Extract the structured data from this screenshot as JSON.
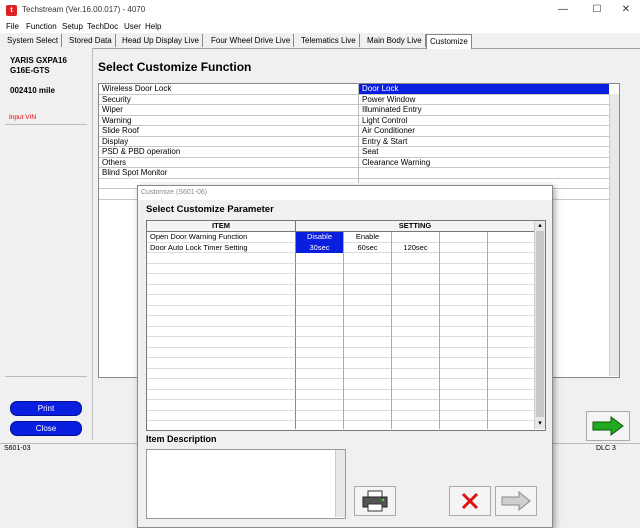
{
  "window": {
    "title": "Techstream (Ver.16.00.017) - 4070",
    "controls": {
      "minimize": "—",
      "maximize": "☐",
      "close": "✕"
    }
  },
  "menu": [
    "File",
    "Function",
    "Setup",
    "TechDoc",
    "User",
    "Help"
  ],
  "tabs": [
    "System Select",
    "Stored Data",
    "Head Up Display Live",
    "Four Wheel Drive Live",
    "Telematics Live",
    "Main Body Live",
    "Customize"
  ],
  "active_tab": "Customize",
  "vehicle": {
    "model": "YARIS GXPA16",
    "engine": "G16E-GTS",
    "mileage": "002410 mile",
    "input_vin": "Input VIN"
  },
  "left_buttons": {
    "print": "Print",
    "close": "Close"
  },
  "main": {
    "title": "Select Customize Function",
    "functions_left": [
      "Wireless Door Lock",
      "Security",
      "Wiper",
      "Warning",
      "Slide Roof",
      "Display",
      "PSD & PBD operation",
      "Others",
      "Blind Spot Monitor"
    ],
    "functions_right": [
      "Door Lock",
      "Power Window",
      "Illuminated Entry",
      "Light Control",
      "Air Conditioner",
      "Entry & Start",
      "Seat",
      "Clearance Warning"
    ],
    "selected_function": "Door Lock"
  },
  "status": {
    "left": "S601-03",
    "right": "DLC 3"
  },
  "dialog": {
    "title": "Customize (S601-06)",
    "heading": "Select Customize Parameter",
    "col_item": "ITEM",
    "col_setting": "SETTING",
    "rows": [
      {
        "item": "Open Door Warning Function",
        "options": [
          "Disable",
          "Enable"
        ],
        "selected": "Disable"
      },
      {
        "item": "Door Auto Lock Timer Setting",
        "options": [
          "30sec",
          "60sec",
          "120sec"
        ],
        "selected": "30sec"
      }
    ],
    "description_label": "Item Description"
  },
  "icons": {
    "next": "right-arrow-icon",
    "print": "printer-icon",
    "cancel": "red-x-icon"
  },
  "colors": {
    "selection": "#0a1ee0",
    "next_arrow": "#22aa22",
    "cancel": "#dd1111"
  }
}
